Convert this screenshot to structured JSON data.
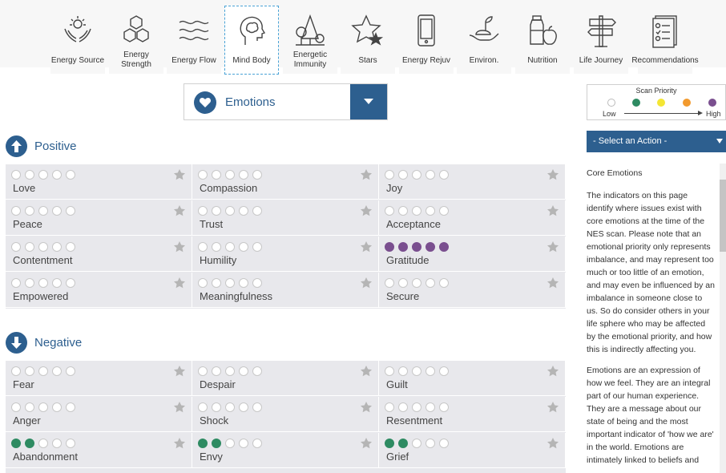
{
  "nav": [
    {
      "label": "Energy Source",
      "icon": "hands-sun-icon"
    },
    {
      "label": "Energy\nStrength",
      "icon": "hexagon-cluster-icon"
    },
    {
      "label": "Energy Flow",
      "icon": "wave-lines-icon"
    },
    {
      "label": "Mind Body",
      "icon": "head-brain-icon",
      "active": true
    },
    {
      "label": "Energetic\nImmunity",
      "icon": "trees-icon"
    },
    {
      "label": "Stars",
      "icon": "stars-icon"
    },
    {
      "label": "Energy Rejuv",
      "icon": "phone-icon"
    },
    {
      "label": "Environ.",
      "icon": "hand-plant-icon"
    },
    {
      "label": "Nutrition",
      "icon": "bottle-apple-icon"
    },
    {
      "label": "Life Journey",
      "icon": "signpost-icon"
    },
    {
      "label": "Recommendations",
      "icon": "checklist-icon"
    }
  ],
  "dropdown": {
    "label": "Emotions"
  },
  "positive": {
    "title": "Positive",
    "cells": [
      {
        "label": "Love",
        "filled": 0,
        "color": ""
      },
      {
        "label": "Compassion",
        "filled": 0,
        "color": ""
      },
      {
        "label": "Joy",
        "filled": 0,
        "color": ""
      },
      {
        "label": "Peace",
        "filled": 0,
        "color": ""
      },
      {
        "label": "Trust",
        "filled": 0,
        "color": ""
      },
      {
        "label": "Acceptance",
        "filled": 0,
        "color": ""
      },
      {
        "label": "Contentment",
        "filled": 0,
        "color": ""
      },
      {
        "label": "Humility",
        "filled": 0,
        "color": ""
      },
      {
        "label": "Gratitude",
        "filled": 5,
        "color": "#7a4f8f"
      },
      {
        "label": "Empowered",
        "filled": 0,
        "color": ""
      },
      {
        "label": "Meaningfulness",
        "filled": 0,
        "color": ""
      },
      {
        "label": "Secure",
        "filled": 0,
        "color": ""
      }
    ]
  },
  "negative": {
    "title": "Negative",
    "cells": [
      {
        "label": "Fear",
        "filled": 0,
        "color": ""
      },
      {
        "label": "Despair",
        "filled": 0,
        "color": ""
      },
      {
        "label": "Guilt",
        "filled": 0,
        "color": ""
      },
      {
        "label": "Anger",
        "filled": 0,
        "color": ""
      },
      {
        "label": "Shock",
        "filled": 0,
        "color": ""
      },
      {
        "label": "Resentment",
        "filled": 0,
        "color": ""
      },
      {
        "label": "Abandonment",
        "filled": 2,
        "color": "#2e8b62"
      },
      {
        "label": "Envy",
        "filled": 2,
        "color": "#2e8b62"
      },
      {
        "label": "Grief",
        "filled": 2,
        "color": "#2e8b62"
      }
    ]
  },
  "legend": {
    "title": "Scan Priority",
    "low": "Low",
    "high": "High",
    "colors": [
      "#ffffff",
      "#2e8b62",
      "#f4e634",
      "#f29a2e",
      "#7a4f8f"
    ]
  },
  "action": {
    "label": "- Select an Action -"
  },
  "description": {
    "heading": "Core Emotions",
    "p1": "The indicators on this page identify where issues exist with core emotions at the time of the NES scan. Please note that an emotional priority only represents imbalance, and may represent too much or too little of an emotion, and may even be influenced by an imbalance in someone close to us. So do consider others in your life sphere who may be affected by the emotional priority, and how this is indirectly affecting you.",
    "p2": "Emotions are an expression of how we feel. They are an integral part of our human experience. They are a message about our state of being and the most important indicator of 'how we are' in the world. Emotions are intimately linked to beliefs and"
  },
  "theme": {
    "primary": "#2d5f8f",
    "cell_bg": "#e8e8ec",
    "star": "#b5b5b5"
  }
}
